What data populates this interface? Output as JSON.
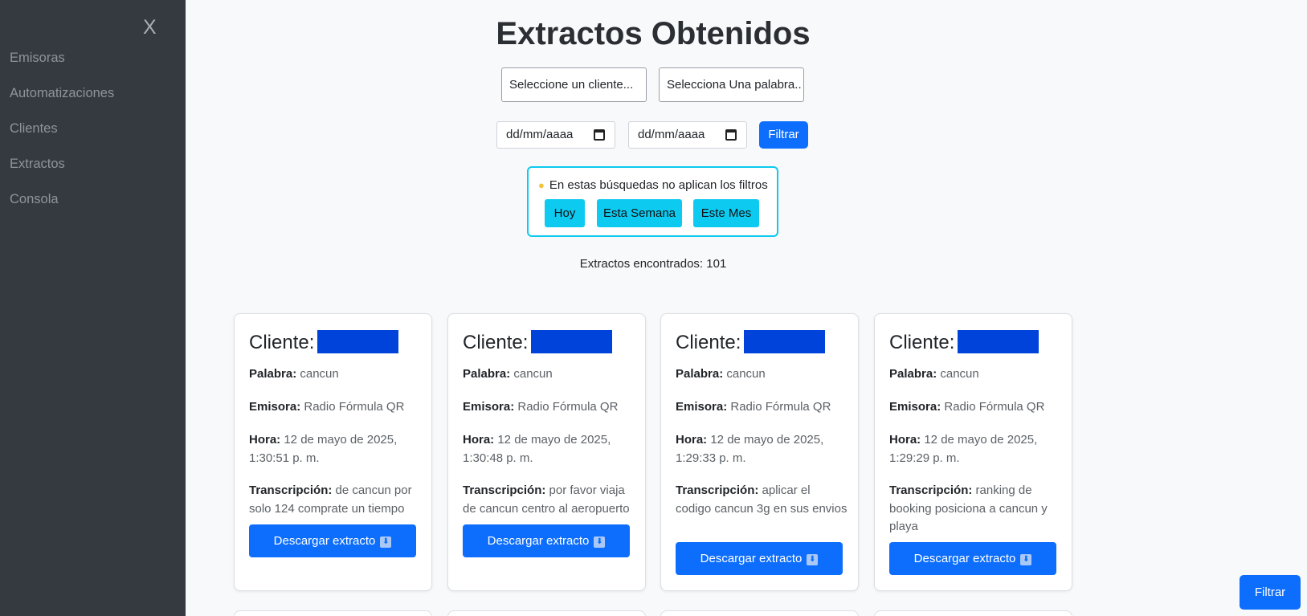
{
  "sidebar": {
    "close_label": "X",
    "items": [
      {
        "label": "Emisoras"
      },
      {
        "label": "Automatizaciones"
      },
      {
        "label": "Clientes"
      },
      {
        "label": "Extractos"
      },
      {
        "label": "Consola"
      }
    ]
  },
  "page": {
    "title": "Extractos Obtenidos",
    "client_select": "Seleccione un cliente...",
    "word_select": "Selecciona Una palabra..",
    "date_from_placeholder": "dd/mm/aaaa",
    "date_to_placeholder": "dd/mm/aaaa",
    "filter_label": "Filtrar",
    "quick_hint": "En estas búsquedas no aplican los filtros",
    "quick_buttons": [
      "Hoy",
      "Esta Semana",
      "Este Mes"
    ],
    "count_label": "Extractos encontrados: 101",
    "floating_filter_label": "Filtrar"
  },
  "labels": {
    "client": "Cliente:",
    "word": "Palabra:",
    "station": "Emisora:",
    "time": "Hora:",
    "transcription": "Transcripción:",
    "download": "Descargar extracto"
  },
  "cards": [
    {
      "word": "cancun",
      "station": "Radio Fórmula QR",
      "time": "12 de mayo de 2025, 1:30:51 p. m.",
      "transcription": "de cancun por solo 124 comprate un tiempo"
    },
    {
      "word": "cancun",
      "station": "Radio Fórmula QR",
      "time": "12 de mayo de 2025, 1:30:48 p. m.",
      "transcription": "por favor viaja de cancun centro al aeropuerto"
    },
    {
      "word": "cancun",
      "station": "Radio Fórmula QR",
      "time": "12 de mayo de 2025, 1:29:33 p. m.",
      "transcription": "aplicar el codigo cancun 3g en sus envios"
    },
    {
      "word": "cancun",
      "station": "Radio Fórmula QR",
      "time": "12 de mayo de 2025, 1:29:29 p. m.",
      "transcription": "ranking de booking posiciona a cancun y playa"
    }
  ],
  "colors": {
    "sidebar": "#343a40",
    "primary": "#0d6efd",
    "info": "#0dcaf0",
    "redaction": "#0043db"
  }
}
